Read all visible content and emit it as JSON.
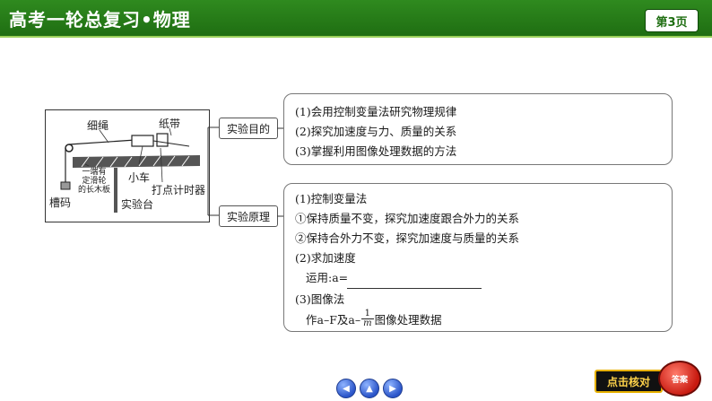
{
  "header": {
    "title": "高考一轮总复习•物理",
    "page_label": "第3页",
    "colors": {
      "bar": "#1f6e12",
      "accent": "#9bd05a"
    }
  },
  "figure": {
    "labels": {
      "string": "细绳",
      "tape": "纸带",
      "pulley_board": "一端有\n定滑轮\n的长木板",
      "cart": "小车",
      "timer": "打点计时器",
      "weight": "槽码",
      "table": "实验台"
    }
  },
  "purpose": {
    "tag": "实验目的",
    "lines": [
      "(1)会用控制变量法研究物理规律",
      "(2)探究加速度与力、质量的关系",
      "(3)掌握利用图像处理数据的方法"
    ]
  },
  "principle": {
    "tag": "实验原理",
    "lines": [
      "(1)控制变量法",
      "①保持质量不变，探究加速度跟合外力的关系",
      "②保持合外力不变，探究加速度与质量的关系",
      "(2)求加速度",
      "运用:a=",
      "(3)图像法"
    ],
    "graph_prefix": "作a–F及a–",
    "graph_frac_num": "1",
    "graph_frac_den": "m",
    "graph_suffix": "图像处理数据"
  },
  "footer": {
    "nav": [
      "prev-icon",
      "up-icon",
      "next-icon"
    ],
    "check_label": "点击核对",
    "answer_label": "答案"
  }
}
